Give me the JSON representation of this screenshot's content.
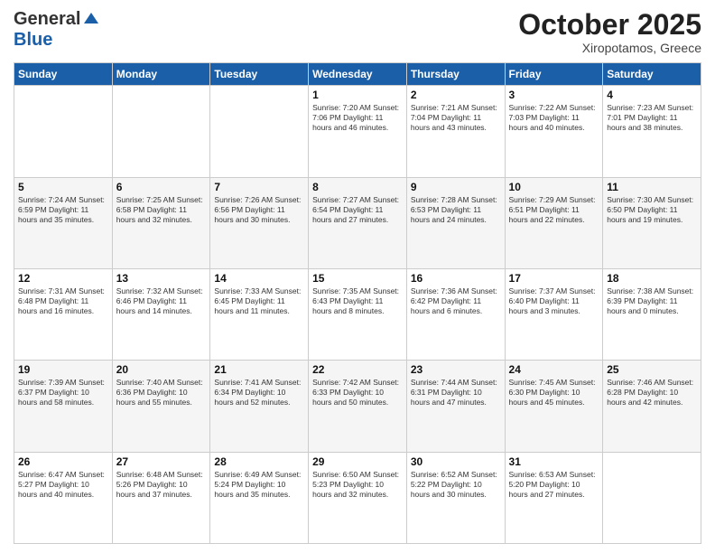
{
  "header": {
    "logo_general": "General",
    "logo_blue": "Blue",
    "month": "October 2025",
    "location": "Xiropotamos, Greece"
  },
  "days_of_week": [
    "Sunday",
    "Monday",
    "Tuesday",
    "Wednesday",
    "Thursday",
    "Friday",
    "Saturday"
  ],
  "weeks": [
    {
      "days": [
        {
          "num": "",
          "info": ""
        },
        {
          "num": "",
          "info": ""
        },
        {
          "num": "",
          "info": ""
        },
        {
          "num": "1",
          "info": "Sunrise: 7:20 AM\nSunset: 7:06 PM\nDaylight: 11 hours\nand 46 minutes."
        },
        {
          "num": "2",
          "info": "Sunrise: 7:21 AM\nSunset: 7:04 PM\nDaylight: 11 hours\nand 43 minutes."
        },
        {
          "num": "3",
          "info": "Sunrise: 7:22 AM\nSunset: 7:03 PM\nDaylight: 11 hours\nand 40 minutes."
        },
        {
          "num": "4",
          "info": "Sunrise: 7:23 AM\nSunset: 7:01 PM\nDaylight: 11 hours\nand 38 minutes."
        }
      ]
    },
    {
      "days": [
        {
          "num": "5",
          "info": "Sunrise: 7:24 AM\nSunset: 6:59 PM\nDaylight: 11 hours\nand 35 minutes."
        },
        {
          "num": "6",
          "info": "Sunrise: 7:25 AM\nSunset: 6:58 PM\nDaylight: 11 hours\nand 32 minutes."
        },
        {
          "num": "7",
          "info": "Sunrise: 7:26 AM\nSunset: 6:56 PM\nDaylight: 11 hours\nand 30 minutes."
        },
        {
          "num": "8",
          "info": "Sunrise: 7:27 AM\nSunset: 6:54 PM\nDaylight: 11 hours\nand 27 minutes."
        },
        {
          "num": "9",
          "info": "Sunrise: 7:28 AM\nSunset: 6:53 PM\nDaylight: 11 hours\nand 24 minutes."
        },
        {
          "num": "10",
          "info": "Sunrise: 7:29 AM\nSunset: 6:51 PM\nDaylight: 11 hours\nand 22 minutes."
        },
        {
          "num": "11",
          "info": "Sunrise: 7:30 AM\nSunset: 6:50 PM\nDaylight: 11 hours\nand 19 minutes."
        }
      ]
    },
    {
      "days": [
        {
          "num": "12",
          "info": "Sunrise: 7:31 AM\nSunset: 6:48 PM\nDaylight: 11 hours\nand 16 minutes."
        },
        {
          "num": "13",
          "info": "Sunrise: 7:32 AM\nSunset: 6:46 PM\nDaylight: 11 hours\nand 14 minutes."
        },
        {
          "num": "14",
          "info": "Sunrise: 7:33 AM\nSunset: 6:45 PM\nDaylight: 11 hours\nand 11 minutes."
        },
        {
          "num": "15",
          "info": "Sunrise: 7:35 AM\nSunset: 6:43 PM\nDaylight: 11 hours\nand 8 minutes."
        },
        {
          "num": "16",
          "info": "Sunrise: 7:36 AM\nSunset: 6:42 PM\nDaylight: 11 hours\nand 6 minutes."
        },
        {
          "num": "17",
          "info": "Sunrise: 7:37 AM\nSunset: 6:40 PM\nDaylight: 11 hours\nand 3 minutes."
        },
        {
          "num": "18",
          "info": "Sunrise: 7:38 AM\nSunset: 6:39 PM\nDaylight: 11 hours\nand 0 minutes."
        }
      ]
    },
    {
      "days": [
        {
          "num": "19",
          "info": "Sunrise: 7:39 AM\nSunset: 6:37 PM\nDaylight: 10 hours\nand 58 minutes."
        },
        {
          "num": "20",
          "info": "Sunrise: 7:40 AM\nSunset: 6:36 PM\nDaylight: 10 hours\nand 55 minutes."
        },
        {
          "num": "21",
          "info": "Sunrise: 7:41 AM\nSunset: 6:34 PM\nDaylight: 10 hours\nand 52 minutes."
        },
        {
          "num": "22",
          "info": "Sunrise: 7:42 AM\nSunset: 6:33 PM\nDaylight: 10 hours\nand 50 minutes."
        },
        {
          "num": "23",
          "info": "Sunrise: 7:44 AM\nSunset: 6:31 PM\nDaylight: 10 hours\nand 47 minutes."
        },
        {
          "num": "24",
          "info": "Sunrise: 7:45 AM\nSunset: 6:30 PM\nDaylight: 10 hours\nand 45 minutes."
        },
        {
          "num": "25",
          "info": "Sunrise: 7:46 AM\nSunset: 6:28 PM\nDaylight: 10 hours\nand 42 minutes."
        }
      ]
    },
    {
      "days": [
        {
          "num": "26",
          "info": "Sunrise: 6:47 AM\nSunset: 5:27 PM\nDaylight: 10 hours\nand 40 minutes."
        },
        {
          "num": "27",
          "info": "Sunrise: 6:48 AM\nSunset: 5:26 PM\nDaylight: 10 hours\nand 37 minutes."
        },
        {
          "num": "28",
          "info": "Sunrise: 6:49 AM\nSunset: 5:24 PM\nDaylight: 10 hours\nand 35 minutes."
        },
        {
          "num": "29",
          "info": "Sunrise: 6:50 AM\nSunset: 5:23 PM\nDaylight: 10 hours\nand 32 minutes."
        },
        {
          "num": "30",
          "info": "Sunrise: 6:52 AM\nSunset: 5:22 PM\nDaylight: 10 hours\nand 30 minutes."
        },
        {
          "num": "31",
          "info": "Sunrise: 6:53 AM\nSunset: 5:20 PM\nDaylight: 10 hours\nand 27 minutes."
        },
        {
          "num": "",
          "info": ""
        }
      ]
    }
  ]
}
